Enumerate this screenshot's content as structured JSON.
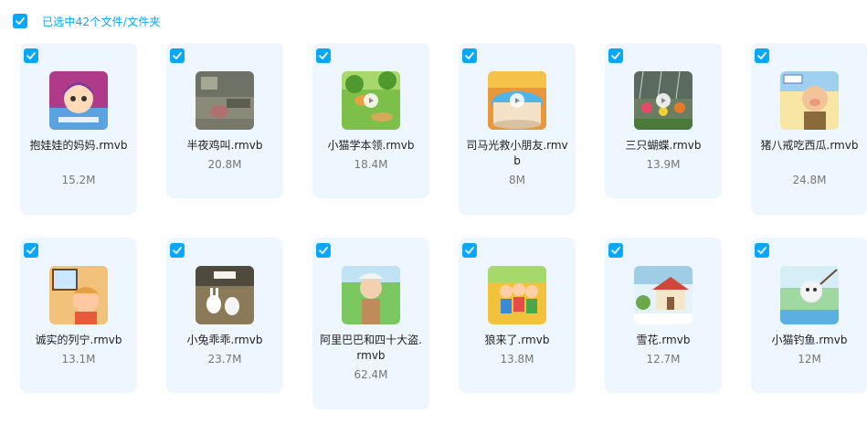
{
  "selection": {
    "label": "已选中42个文件/文件夹",
    "checked": true
  },
  "colors": {
    "accent": "#06a7ff",
    "card_bg": "#eef6ff"
  },
  "files": [
    {
      "name": "抱娃娃的妈妈.rmvb",
      "size": "15.2M",
      "checked": true,
      "thumb": "cartoon-girl",
      "play": false
    },
    {
      "name": "半夜鸡叫.rmvb",
      "size": "20.8M",
      "checked": true,
      "thumb": "night-room",
      "play": false
    },
    {
      "name": "小猫学本领.rmvb",
      "size": "18.4M",
      "checked": true,
      "thumb": "forest-cat",
      "play": true
    },
    {
      "name": "司马光救小朋友.rmvb",
      "size": "8M",
      "checked": true,
      "thumb": "water-jar",
      "play": true
    },
    {
      "name": "三只蝴蝶.rmvb",
      "size": "13.9M",
      "checked": true,
      "thumb": "rain-flowers",
      "play": true
    },
    {
      "name": "猪八戒吃西瓜.rmvb",
      "size": "24.8M",
      "checked": true,
      "thumb": "pig-character",
      "play": false
    },
    {
      "name": "诚实的列宁.rmvb",
      "size": "13.1M",
      "checked": true,
      "thumb": "boy-room",
      "play": false
    },
    {
      "name": "小兔乖乖.rmvb",
      "size": "23.7M",
      "checked": true,
      "thumb": "rabbits",
      "play": false
    },
    {
      "name": "阿里巴巴和四十大盗.rmvb",
      "size": "62.4M",
      "checked": true,
      "thumb": "man-field",
      "play": false
    },
    {
      "name": "狼来了.rmvb",
      "size": "13.8M",
      "checked": true,
      "thumb": "kids-field",
      "play": false
    },
    {
      "name": "雪花.rmvb",
      "size": "12.7M",
      "checked": true,
      "thumb": "snow-house",
      "play": false
    },
    {
      "name": "小猫钓鱼.rmvb",
      "size": "12M",
      "checked": true,
      "thumb": "cat-fishing",
      "play": false
    }
  ]
}
